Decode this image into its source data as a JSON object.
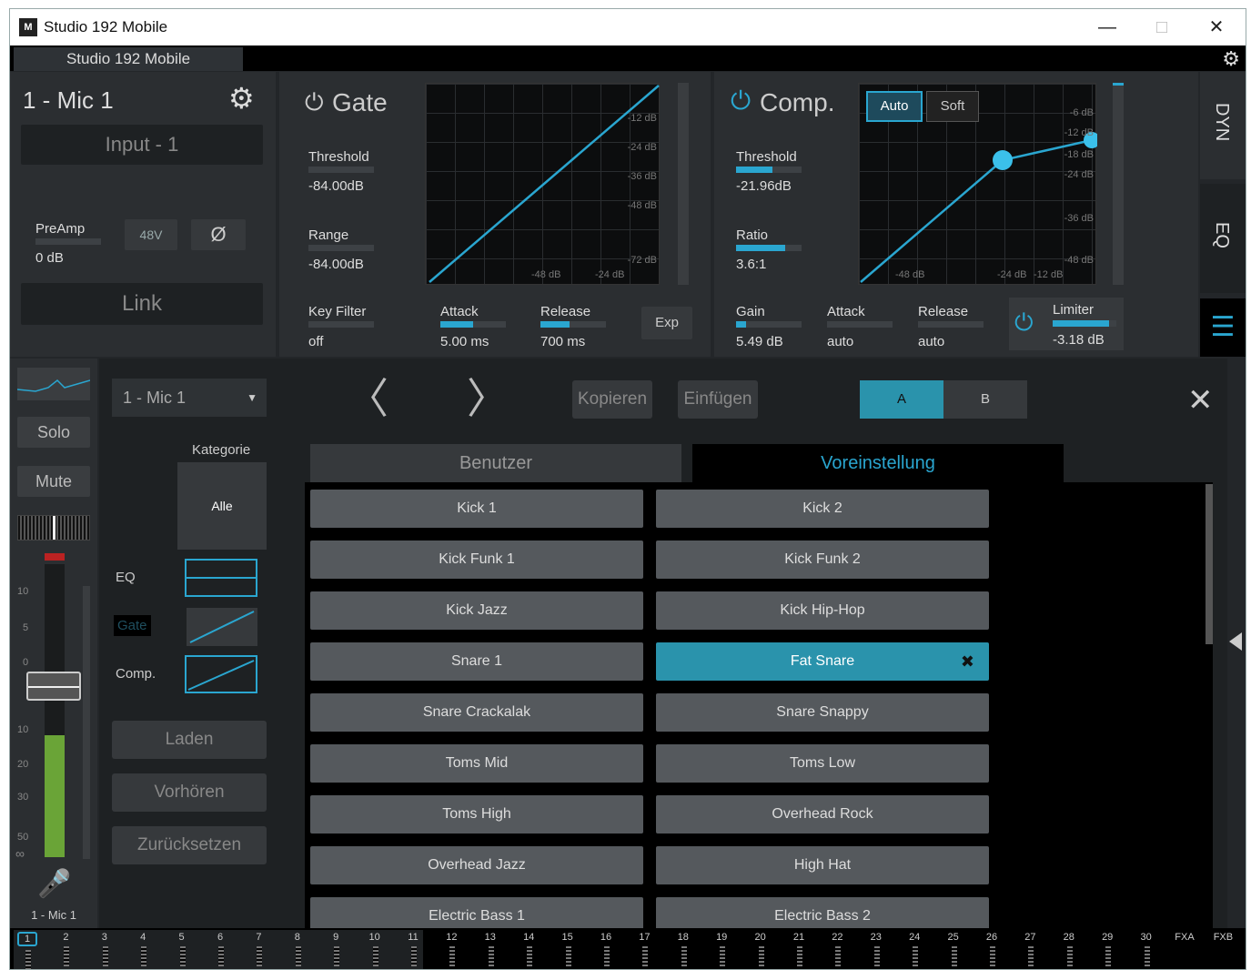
{
  "window": {
    "title": "Studio 192 Mobile",
    "icon_text": "M",
    "min": "—",
    "max": "□",
    "close": "✕"
  },
  "device_tab": "Studio 192 Mobile",
  "channel": {
    "name": "1 - Mic 1",
    "input": "Input - 1",
    "preamp_label": "PreAmp",
    "preamp_value": "0 dB",
    "phantom": "48V",
    "phase": "Ø",
    "link": "Link"
  },
  "gate": {
    "title": "Gate",
    "threshold_label": "Threshold",
    "threshold_value": "-84.00dB",
    "threshold_fill": 0,
    "range_label": "Range",
    "range_value": "-84.00dB",
    "range_fill": 0,
    "keyfilter_label": "Key Filter",
    "keyfilter_value": "off",
    "attack_label": "Attack",
    "attack_value": "5.00 ms",
    "attack_fill": 0.5,
    "release_label": "Release",
    "release_value": "700 ms",
    "release_fill": 0.45,
    "exp": "Exp",
    "ticks_y": [
      "-12 dB",
      "-24 dB",
      "-36 dB",
      "-48 dB",
      "-72 dB"
    ],
    "ticks_x": [
      "-48 dB",
      "-24 dB"
    ]
  },
  "comp": {
    "title": "Comp.",
    "auto": "Auto",
    "soft": "Soft",
    "threshold_label": "Threshold",
    "threshold_value": "-21.96dB",
    "threshold_fill": 0.55,
    "ratio_label": "Ratio",
    "ratio_value": "3.6:1",
    "ratio_fill": 0.75,
    "gain_label": "Gain",
    "gain_value": "5.49 dB",
    "gain_fill": 0.15,
    "attack_label": "Attack",
    "attack_value": "auto",
    "release_label": "Release",
    "release_value": "auto",
    "limiter_label": "Limiter",
    "limiter_value": "-3.18 dB",
    "limiter_fill": 0.88,
    "ticks_y": [
      "-6 dB",
      "-12 dB",
      "-18 dB",
      "-24 dB",
      "-36 dB",
      "-48 dB"
    ],
    "ticks_x": [
      "-48 dB",
      "-24 dB",
      "-12 dB"
    ]
  },
  "side_tabs": {
    "dyn": "DYN",
    "eq": "EQ"
  },
  "strip": {
    "solo": "Solo",
    "mute": "Mute",
    "scale": [
      "10",
      "5",
      "0",
      "10",
      "20",
      "30",
      "50",
      "∞"
    ],
    "name": "1 - Mic 1"
  },
  "presets": {
    "channel_select": "1 - Mic 1",
    "category_label": "Kategorie",
    "category_value": "Alle",
    "eq": "EQ",
    "gate": "Gate",
    "comp": "Comp.",
    "load": "Laden",
    "preview": "Vorhören",
    "reset": "Zurücksetzen",
    "copy": "Kopieren",
    "paste": "Einfügen",
    "a": "A",
    "b": "B",
    "tab_user": "Benutzer",
    "tab_preset": "Voreinstellung",
    "items": [
      "Kick 1",
      "Kick 2",
      "Kick Funk 1",
      "Kick Funk 2",
      "Kick Jazz",
      "Kick Hip-Hop",
      "Snare 1",
      "Fat Snare",
      "Snare Crackalak",
      "Snare Snappy",
      "Toms Mid",
      "Toms Low",
      "Toms High",
      "Overhead Rock",
      "Overhead Jazz",
      "High Hat",
      "Electric Bass 1",
      "Electric Bass 2"
    ],
    "selected": "Fat Snare"
  },
  "channels": [
    "1",
    "2",
    "3",
    "4",
    "5",
    "6",
    "7",
    "8",
    "9",
    "10",
    "11",
    "12",
    "13",
    "14",
    "15",
    "16",
    "17",
    "18",
    "19",
    "20",
    "21",
    "22",
    "23",
    "24",
    "25",
    "26",
    "27",
    "28",
    "29",
    "30",
    "FXA",
    "FXB"
  ],
  "colors": {
    "accent": "#2aa6d0",
    "selected": "#2a93ac",
    "meter": "#6aa437"
  }
}
